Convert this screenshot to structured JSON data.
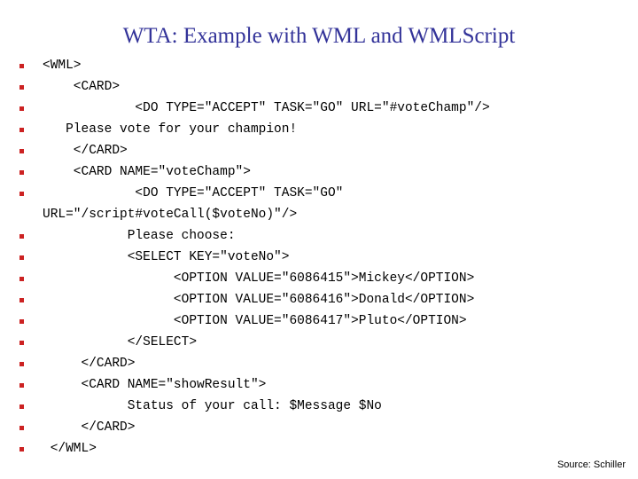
{
  "slide": {
    "title": "WTA: Example with WML and WMLScript",
    "title_color": "#333399",
    "background_color": "#ffffff",
    "bullet_color": "#cc2222",
    "body_color": "#000000",
    "source_note": "Source: Schiller"
  },
  "code_lines": [
    {
      "text": "<WML>",
      "bulleted": true
    },
    {
      "text": "    <CARD>",
      "bulleted": true
    },
    {
      "text": "            <DO TYPE=\"ACCEPT\" TASK=\"GO\" URL=\"#voteChamp\"/>",
      "bulleted": true
    },
    {
      "text": "   Please vote for your champion!",
      "bulleted": true
    },
    {
      "text": "    </CARD>",
      "bulleted": true
    },
    {
      "text": "    <CARD NAME=\"voteChamp\">",
      "bulleted": true
    },
    {
      "text": "            <DO TYPE=\"ACCEPT\" TASK=\"GO\"",
      "bulleted": true
    },
    {
      "text": "URL=\"/script#voteCall($voteNo)\"/>",
      "bulleted": false
    },
    {
      "text": "           Please choose:",
      "bulleted": true
    },
    {
      "text": "           <SELECT KEY=\"voteNo\">",
      "bulleted": true
    },
    {
      "text": "                 <OPTION VALUE=\"6086415\">Mickey</OPTION>",
      "bulleted": true
    },
    {
      "text": "                 <OPTION VALUE=\"6086416\">Donald</OPTION>",
      "bulleted": true
    },
    {
      "text": "                 <OPTION VALUE=\"6086417\">Pluto</OPTION>",
      "bulleted": true
    },
    {
      "text": "           </SELECT>",
      "bulleted": true
    },
    {
      "text": "     </CARD>",
      "bulleted": true
    },
    {
      "text": "     <CARD NAME=\"showResult\">",
      "bulleted": true
    },
    {
      "text": "           Status of your call: $Message $No",
      "bulleted": true
    },
    {
      "text": "     </CARD>",
      "bulleted": true
    },
    {
      "text": " </WML>",
      "bulleted": true
    }
  ]
}
